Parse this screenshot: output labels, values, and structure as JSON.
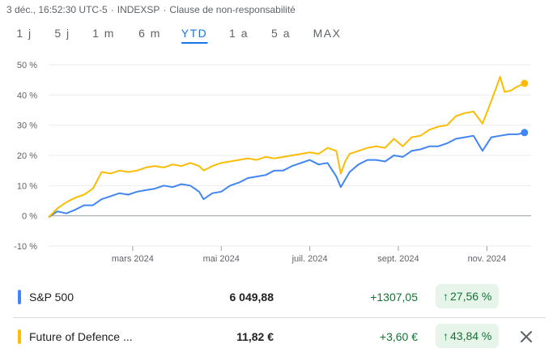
{
  "header": {
    "datetime": "3 déc., 16:52:30 UTC-5",
    "index": "INDEXSP",
    "disclaimer": "Clause de non-responsabilité"
  },
  "tabs": [
    {
      "label": "1 j",
      "active": false
    },
    {
      "label": "5 j",
      "active": false
    },
    {
      "label": "1 m",
      "active": false
    },
    {
      "label": "6 m",
      "active": false
    },
    {
      "label": "YTD",
      "active": true
    },
    {
      "label": "1 a",
      "active": false
    },
    {
      "label": "5 a",
      "active": false
    },
    {
      "label": "MAX",
      "active": false
    }
  ],
  "chart_data": {
    "type": "line",
    "ylim": [
      -10,
      50
    ],
    "yticks": [
      "50 %",
      "40 %",
      "30 %",
      "20 %",
      "10 %",
      "0 %",
      "-10 %"
    ],
    "ytick_values": [
      50,
      40,
      30,
      20,
      10,
      0,
      -10
    ],
    "xticks": [
      "mars 2024",
      "mai 2024",
      "juil. 2024",
      "sept. 2024",
      "nov. 2024"
    ],
    "xtick_positions": [
      1.9,
      3.9,
      5.9,
      7.9,
      9.9
    ],
    "xlim": [
      0,
      10.9
    ],
    "grid": true,
    "series": [
      {
        "name": "S&P 500",
        "color": "#4285f4",
        "x": [
          0,
          0.2,
          0.4,
          0.6,
          0.8,
          1.0,
          1.2,
          1.4,
          1.6,
          1.8,
          2.0,
          2.2,
          2.4,
          2.6,
          2.8,
          3.0,
          3.2,
          3.4,
          3.5,
          3.7,
          3.9,
          4.1,
          4.3,
          4.5,
          4.7,
          4.9,
          5.1,
          5.3,
          5.5,
          5.7,
          5.9,
          6.1,
          6.3,
          6.5,
          6.6,
          6.7,
          6.8,
          7.0,
          7.2,
          7.4,
          7.6,
          7.8,
          8.0,
          8.2,
          8.4,
          8.6,
          8.8,
          9.0,
          9.2,
          9.4,
          9.6,
          9.8,
          10.0,
          10.2,
          10.4,
          10.6,
          10.75
        ],
        "values": [
          -0.5,
          1.5,
          0.8,
          2.0,
          3.5,
          3.5,
          5.5,
          6.5,
          7.5,
          7.0,
          8.0,
          8.5,
          9.0,
          10.0,
          9.5,
          10.5,
          10.0,
          8.0,
          5.5,
          7.5,
          8.0,
          10.0,
          11.0,
          12.5,
          13.0,
          13.5,
          15.0,
          15.0,
          16.5,
          17.5,
          18.5,
          17.0,
          17.5,
          13.0,
          9.5,
          12.0,
          14.5,
          17.0,
          18.5,
          18.5,
          18.0,
          20.0,
          19.5,
          21.5,
          22.0,
          23.0,
          23.0,
          24.0,
          25.5,
          26.0,
          26.5,
          21.5,
          26.0,
          26.5,
          27.0,
          27.0,
          27.56
        ]
      },
      {
        "name": "Future of Defence ...",
        "color": "#fbbc04",
        "x": [
          0,
          0.2,
          0.4,
          0.6,
          0.8,
          1.0,
          1.2,
          1.4,
          1.6,
          1.8,
          2.0,
          2.2,
          2.4,
          2.6,
          2.8,
          3.0,
          3.2,
          3.4,
          3.5,
          3.7,
          3.9,
          4.1,
          4.3,
          4.5,
          4.7,
          4.9,
          5.1,
          5.3,
          5.5,
          5.7,
          5.9,
          6.1,
          6.3,
          6.5,
          6.6,
          6.7,
          6.8,
          7.0,
          7.2,
          7.4,
          7.6,
          7.8,
          8.0,
          8.2,
          8.4,
          8.6,
          8.8,
          9.0,
          9.2,
          9.4,
          9.6,
          9.8,
          10.0,
          10.1,
          10.2,
          10.3,
          10.45,
          10.55,
          10.75
        ],
        "values": [
          -0.5,
          2.5,
          4.5,
          6.0,
          7.0,
          9.0,
          14.5,
          14.0,
          15.0,
          14.5,
          15.0,
          16.0,
          16.5,
          16.0,
          17.0,
          16.5,
          17.5,
          16.5,
          15.0,
          16.5,
          17.5,
          18.0,
          18.5,
          19.0,
          18.5,
          19.5,
          19.0,
          19.5,
          20.0,
          20.5,
          21.0,
          20.5,
          22.5,
          21.5,
          14.0,
          18.0,
          20.5,
          21.5,
          22.5,
          23.0,
          22.5,
          25.5,
          23.0,
          26.0,
          26.5,
          28.5,
          29.5,
          30.0,
          33.0,
          34.0,
          34.5,
          30.5,
          38.0,
          42.0,
          46.0,
          41.0,
          41.5,
          42.5,
          43.84
        ]
      }
    ]
  },
  "legend": [
    {
      "name": "S&P 500",
      "price": "6 049,88",
      "change": "+1307,05",
      "change_pct": "27,56 %",
      "arrow": "↑",
      "color": "#4285f4",
      "removable": false
    },
    {
      "name": "Future of Defence ...",
      "price": "11,82 €",
      "change": "+3,60 €",
      "change_pct": "43,84 %",
      "arrow": "↑",
      "color": "#fbbc04",
      "removable": true
    }
  ]
}
